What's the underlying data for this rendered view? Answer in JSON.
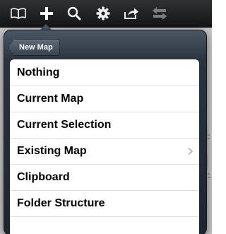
{
  "toolbar": {
    "buttons": [
      {
        "name": "book-icon"
      },
      {
        "name": "plus-icon"
      },
      {
        "name": "search-icon"
      },
      {
        "name": "gear-icon"
      },
      {
        "name": "share-icon"
      },
      {
        "name": "undo-redo-icon"
      }
    ]
  },
  "popover": {
    "back_label": "New Map",
    "items": [
      {
        "label": "Nothing"
      },
      {
        "label": "Current Map"
      },
      {
        "label": "Current Selection"
      },
      {
        "label": "Existing Map",
        "has_chevron": true
      },
      {
        "label": "Clipboard"
      },
      {
        "label": "Folder Structure"
      }
    ]
  },
  "colors": {
    "toolbar_top": "#2f3134",
    "toolbar_bottom": "#141516",
    "popover_top": "#4c5764",
    "popover_bottom": "#1e2530",
    "list_bg": "#ffffff"
  }
}
